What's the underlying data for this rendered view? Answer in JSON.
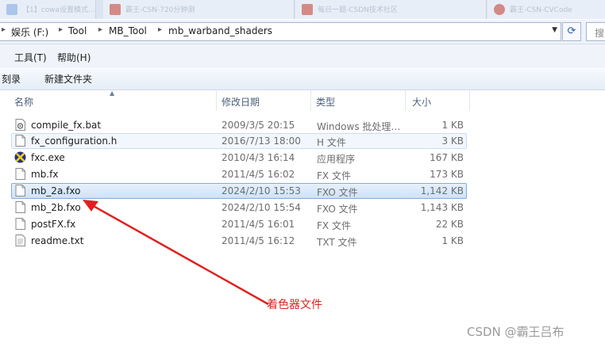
{
  "browser_tabs": [
    {
      "label": "【1】cowa设置模式…",
      "icon_color": "#3a7bd5"
    },
    {
      "label": "霸王-CSN-720分钟测",
      "icon_color": "#c0392b"
    },
    {
      "label": "每日一题-CSDN技术社区",
      "icon_color": "#c0392b"
    },
    {
      "label": "霸王-CSN-CVCode",
      "icon_color": "#c0392b"
    }
  ],
  "address": {
    "crumbs": [
      "娱乐 (F:)",
      "Tool",
      "MB_Tool",
      "mb_warband_shaders"
    ],
    "search_placeholder": "搜"
  },
  "menu": {
    "tools": "工具(T)",
    "help": "帮助(H)"
  },
  "toolbar": {
    "burn": "刻录",
    "new_folder": "新建文件夹"
  },
  "columns": {
    "name": "名称",
    "date": "修改日期",
    "type": "类型",
    "size": "大小"
  },
  "files": [
    {
      "name": "compile_fx.bat",
      "date": "2009/3/5 20:15",
      "type": "Windows 批处理…",
      "size": "1 KB",
      "icon": "batch-file-icon"
    },
    {
      "name": "fx_configuration.h",
      "date": "2016/7/13 18:00",
      "type": "H 文件",
      "size": "3 KB",
      "icon": "file-icon"
    },
    {
      "name": "fxc.exe",
      "date": "2010/4/3 16:14",
      "type": "应用程序",
      "size": "167 KB",
      "icon": "exe-icon"
    },
    {
      "name": "mb.fx",
      "date": "2011/4/5 16:02",
      "type": "FX 文件",
      "size": "173 KB",
      "icon": "file-icon"
    },
    {
      "name": "mb_2a.fxo",
      "date": "2024/2/10 15:53",
      "type": "FXO 文件",
      "size": "1,142 KB",
      "icon": "file-icon"
    },
    {
      "name": "mb_2b.fxo",
      "date": "2024/2/10 15:54",
      "type": "FXO 文件",
      "size": "1,143 KB",
      "icon": "file-icon"
    },
    {
      "name": "postFX.fx",
      "date": "2011/4/5 16:01",
      "type": "FX 文件",
      "size": "22 KB",
      "icon": "file-icon"
    },
    {
      "name": "readme.txt",
      "date": "2011/4/5 16:12",
      "type": "TXT 文件",
      "size": "1 KB",
      "icon": "text-file-icon"
    }
  ],
  "annotation": {
    "text": "着色器文件",
    "color": "#e02020"
  },
  "watermark": "CSDN @霸王吕布"
}
